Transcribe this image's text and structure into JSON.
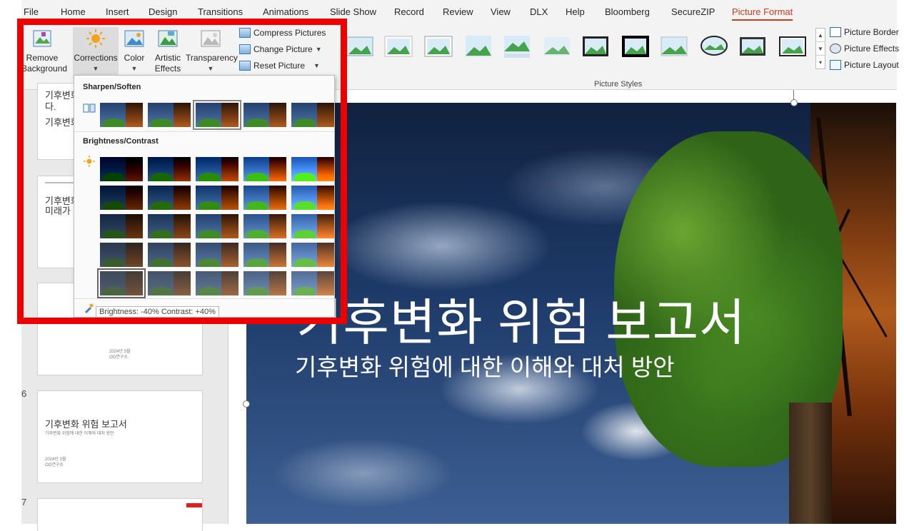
{
  "menu": {
    "tabs": [
      "File",
      "Home",
      "Insert",
      "Design",
      "Transitions",
      "Animations",
      "Slide Show",
      "Record",
      "Review",
      "View",
      "DLX",
      "Help",
      "Bloomberg",
      "SecureZIP",
      "Picture Format"
    ],
    "active": "Picture Format"
  },
  "ribbon": {
    "remove_background": [
      "Remove",
      "Background"
    ],
    "corrections": "Corrections",
    "color": "Color",
    "artistic_effects": [
      "Artistic",
      "Effects"
    ],
    "transparency": "Transparency",
    "compress": "Compress Pictures",
    "change_picture": "Change Picture",
    "reset_picture": "Reset Picture",
    "picture_styles_label": "Picture Styles",
    "picture_border": "Picture Border",
    "picture_effects": "Picture Effects",
    "picture_layout": "Picture Layout"
  },
  "corrections_menu": {
    "sharpen_soften": "Sharpen/Soften",
    "brightness_contrast": "Brightness/Contrast",
    "tooltip": "Brightness: -40% Contrast: +40%"
  },
  "thumbnails": {
    "t1_title": "기후변화",
    "t1_line": "다.",
    "t1_title2": "기후변화",
    "t2_title": "기후변화",
    "t2_line": "미래가 중",
    "t3_date": "2024년 3월",
    "t3_org": "OO연구소",
    "t4_num": "6",
    "t4_title": "기후변화 위험 보고서",
    "t4_sub": "기후변화 위험에 대한 이해와 대처 방안",
    "t4_date": "2024년 3월",
    "t4_org": "OO연구소",
    "t5_num": "7"
  },
  "slide": {
    "title": "기후변화 위험 보고서",
    "subtitle": "기후변화 위험에 대한 이해와 대처 방안"
  },
  "colors": {
    "accent": "#c43e1c",
    "highlight": "#ef0000"
  }
}
